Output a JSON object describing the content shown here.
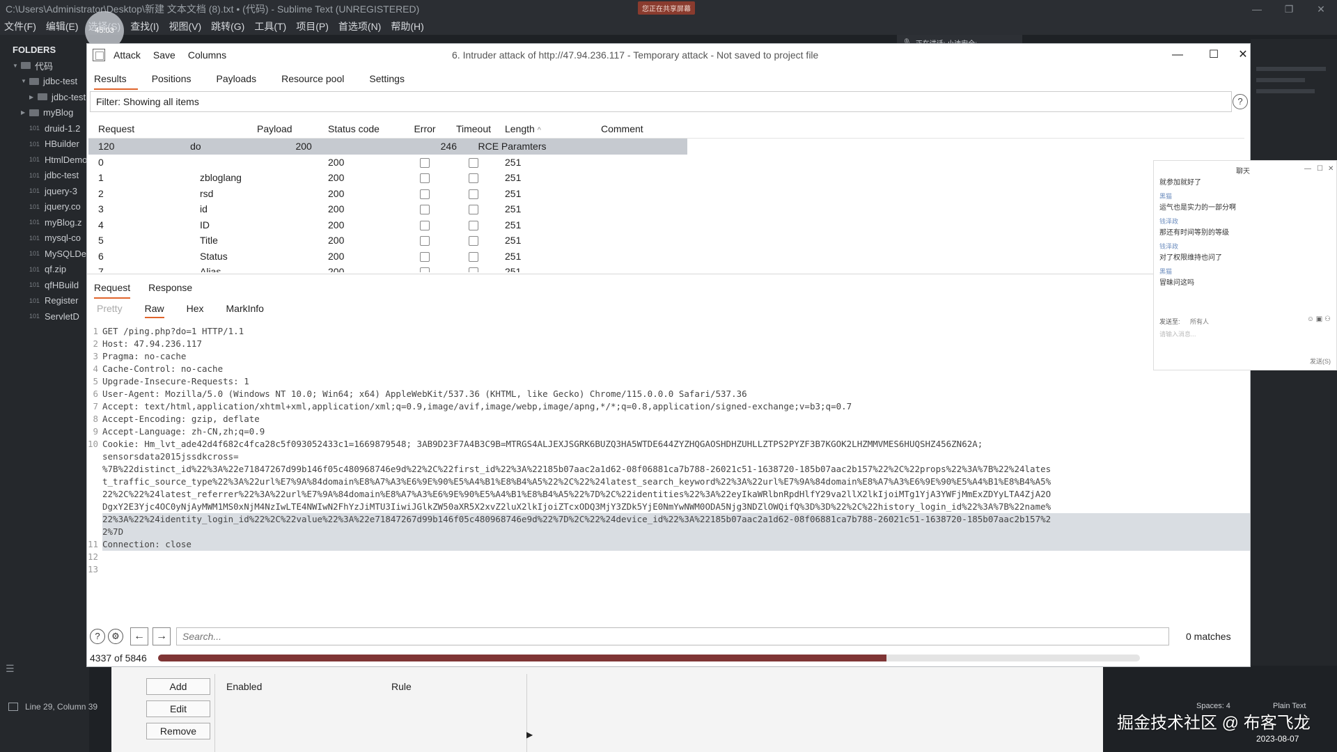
{
  "sublime": {
    "title": "C:\\Users\\Administrator\\Desktop\\新建 文本文档 (8).txt • (代码) - Sublime Text (UNREGISTERED)",
    "share_badge": "您正在共享屏幕",
    "menu": [
      "文件(F)",
      "编辑(E)",
      "选择(S)",
      "查找(I)",
      "视图(V)",
      "跳转(G)",
      "工具(T)",
      "项目(P)",
      "首选项(N)",
      "帮助(H)"
    ],
    "folders_label": "FOLDERS",
    "tree": [
      {
        "label": "代码",
        "kind": "folder",
        "depth": 0,
        "arrow": "▼"
      },
      {
        "label": "jdbc-test",
        "kind": "folder",
        "depth": 1,
        "arrow": "▼"
      },
      {
        "label": "jdbc-test",
        "kind": "folder",
        "depth": 2,
        "arrow": "▶"
      },
      {
        "label": "myBlog",
        "kind": "folder",
        "depth": 1,
        "arrow": "▶"
      },
      {
        "label": "druid-1.2",
        "kind": "file",
        "depth": 1,
        "arrow": ""
      },
      {
        "label": "HBuilder",
        "kind": "file",
        "depth": 1,
        "arrow": ""
      },
      {
        "label": "HtmlDemo",
        "kind": "file",
        "depth": 1,
        "arrow": ""
      },
      {
        "label": "jdbc-test",
        "kind": "file",
        "depth": 1,
        "arrow": ""
      },
      {
        "label": "jquery-3",
        "kind": "file",
        "depth": 1,
        "arrow": ""
      },
      {
        "label": "jquery.co",
        "kind": "file",
        "depth": 1,
        "arrow": ""
      },
      {
        "label": "myBlog.z",
        "kind": "file",
        "depth": 1,
        "arrow": ""
      },
      {
        "label": "mysql-co",
        "kind": "file",
        "depth": 1,
        "arrow": ""
      },
      {
        "label": "MySQLDe",
        "kind": "file",
        "depth": 1,
        "arrow": ""
      },
      {
        "label": "qf.zip",
        "kind": "file",
        "depth": 1,
        "arrow": ""
      },
      {
        "label": "qfHBuild",
        "kind": "file",
        "depth": 1,
        "arrow": ""
      },
      {
        "label": "Register",
        "kind": "file",
        "depth": 1,
        "arrow": ""
      },
      {
        "label": "ServletD",
        "kind": "file",
        "depth": 1,
        "arrow": ""
      }
    ],
    "status_text": "Line 29, Column 39",
    "timer": "45:03",
    "speaking": "正在讲话: 小迪安全;",
    "spaces": "Spaces: 4",
    "syntax": "Plain Text"
  },
  "burp": {
    "menu": [
      "Attack",
      "Save",
      "Columns"
    ],
    "window_title": "6. Intruder attack of http://47.94.236.117 - Temporary attack - Not saved to project file",
    "controls": {
      "minimize": "—",
      "maximize": "☐",
      "close": "✕"
    },
    "tabs": [
      "Results",
      "Positions",
      "Payloads",
      "Resource pool",
      "Settings"
    ],
    "filter": "Filter: Showing all items",
    "help": "?",
    "columns": {
      "request": "Request",
      "payload": "Payload",
      "status": "Status code",
      "error": "Error",
      "timeout": "Timeout",
      "length": "Length",
      "sort": "^",
      "comment": "Comment"
    },
    "rows": [
      {
        "request": "120",
        "payload": "do",
        "status": "200",
        "length": "246",
        "comment": "RCE Paramters",
        "checkboxes": false
      },
      {
        "request": "0",
        "payload": "",
        "status": "200",
        "length": "251",
        "comment": "",
        "checkboxes": true
      },
      {
        "request": "1",
        "payload": "zbloglang",
        "status": "200",
        "length": "251",
        "comment": "",
        "checkboxes": true
      },
      {
        "request": "2",
        "payload": "rsd",
        "status": "200",
        "length": "251",
        "comment": "",
        "checkboxes": true
      },
      {
        "request": "3",
        "payload": "id",
        "status": "200",
        "length": "251",
        "comment": "",
        "checkboxes": true
      },
      {
        "request": "4",
        "payload": "ID",
        "status": "200",
        "length": "251",
        "comment": "",
        "checkboxes": true
      },
      {
        "request": "5",
        "payload": "Title",
        "status": "200",
        "length": "251",
        "comment": "",
        "checkboxes": true
      },
      {
        "request": "6",
        "payload": "Status",
        "status": "200",
        "length": "251",
        "comment": "",
        "checkboxes": true
      },
      {
        "request": "7",
        "payload": "Alias",
        "status": "200",
        "length": "251",
        "comment": "",
        "checkboxes": true
      }
    ],
    "detail_tabs": [
      "Request",
      "Response"
    ],
    "view_tabs": [
      "Pretty",
      "Raw",
      "Hex",
      "MarkInfo"
    ],
    "code_lines": [
      {
        "n": "1",
        "text": "GET /ping.php?do=1 HTTP/1.1",
        "hl": false
      },
      {
        "n": "2",
        "text": "Host: 47.94.236.117",
        "hl": false
      },
      {
        "n": "3",
        "text": "Pragma: no-cache",
        "hl": false
      },
      {
        "n": "4",
        "text": "Cache-Control: no-cache",
        "hl": false
      },
      {
        "n": "5",
        "text": "Upgrade-Insecure-Requests: 1",
        "hl": false
      },
      {
        "n": "6",
        "text": "User-Agent: Mozilla/5.0 (Windows NT 10.0; Win64; x64) AppleWebKit/537.36 (KHTML, like Gecko) Chrome/115.0.0.0 Safari/537.36",
        "hl": false
      },
      {
        "n": "7",
        "text": "Accept: text/html,application/xhtml+xml,application/xml;q=0.9,image/avif,image/webp,image/apng,*/*;q=0.8,application/signed-exchange;v=b3;q=0.7",
        "hl": false
      },
      {
        "n": "8",
        "text": "Accept-Encoding: gzip, deflate",
        "hl": false
      },
      {
        "n": "9",
        "text": "Accept-Language: zh-CN,zh;q=0.9",
        "hl": false
      },
      {
        "n": "10",
        "text": "Cookie: Hm_lvt_ade42d4f682c4fca28c5f093052433c1=1669879548; 3AB9D23F7A4B3C9B=MTRGS4ALJEXJSGRK6BUZQ3HA5WTDE644ZYZHQGAOSHDHZUHLLZTPS2PYZF3B7KGOK2LHZMMVMES6HUQSHZ456ZN62A;",
        "hl": false
      },
      {
        "n": "",
        "text": "sensorsdata2015jssdkcross=",
        "hl": false
      },
      {
        "n": "",
        "text": "%7B%22distinct_id%22%3A%22e71847267d99b146f05c480968746e9d%22%2C%22first_id%22%3A%22185b07aac2a1d62-08f06881ca7b788-26021c51-1638720-185b07aac2b157%22%2C%22props%22%3A%7B%22%24lates",
        "hl": false
      },
      {
        "n": "",
        "text": "t_traffic_source_type%22%3A%22url%E7%9A%84domain%E8%A7%A3%E6%9E%90%E5%A4%B1%E8%B4%A5%22%2C%22%24latest_search_keyword%22%3A%22url%E7%9A%84domain%E8%A7%A3%E6%9E%90%E5%A4%B1%E8%B4%A5%",
        "hl": false
      },
      {
        "n": "",
        "text": "22%2C%22%24latest_referrer%22%3A%22url%E7%9A%84domain%E8%A7%A3%E6%9E%90%E5%A4%B1%E8%B4%A5%22%7D%2C%22identities%22%3A%22eyIkaWRlbnRpdHlfY29va2llX2lkIjoiMTg1YjA3YWFjMmExZDYyLTA4ZjA2O",
        "hl": false
      },
      {
        "n": "",
        "text": "DgxY2E3Yjc4OC0yNjAyMWM1MS0xNjM4NzIwLTE4NWIwN2FhYzJiMTU3IiwiJGlkZW50aXR5X2xvZ2luX2lkIjoiZTcxODQ3MjY3ZDk5YjE0NmYwNWM0ODA5Njg3NDZlOWQifQ%3D%3D%22%2C%22history_login_id%22%3A%7B%22name%",
        "hl": false
      },
      {
        "n": "",
        "text": "22%3A%22%24identity_login_id%22%2C%22value%22%3A%22e71847267d99b146f05c480968746e9d%22%7D%2C%22%24device_id%22%3A%22185b07aac2a1d62-08f06881ca7b788-26021c51-1638720-185b07aac2b157%2",
        "hl": true
      },
      {
        "n": "",
        "text": "2%7D",
        "hl": true
      },
      {
        "n": "11",
        "text": "Connection: close",
        "hl": true
      },
      {
        "n": "12",
        "text": "",
        "hl": false
      },
      {
        "n": "13",
        "text": "",
        "hl": false
      }
    ],
    "search_placeholder": "Search...",
    "matches": "0 matches",
    "progress_label": "4337 of 5846",
    "progress_fraction": 0.7419
  },
  "bottom_panel": {
    "buttons": [
      "Add",
      "Edit",
      "Remove"
    ],
    "headers": {
      "enabled": "Enabled",
      "rule": "Rule"
    }
  },
  "chat": {
    "title": "聊天",
    "messages": [
      {
        "name": "",
        "text": "就参加就好了"
      },
      {
        "name": "黑猫",
        "text": "运气也是实力的一部分啊"
      },
      {
        "name": "钱泽政",
        "text": "那还有时间等别的等级"
      },
      {
        "name": "钱泽政",
        "text": "对了权限维持也问了"
      },
      {
        "name": "黑猫",
        "text": "冒昧问这吗"
      }
    ],
    "send_to_label": "发送至:",
    "send_to_value": "所有人",
    "input_placeholder": "请输入消息...",
    "send_button": "发送(S)"
  },
  "overlay": {
    "watermark": "掘金技术社区 @ 布客飞龙",
    "date": "2023-08-07"
  }
}
